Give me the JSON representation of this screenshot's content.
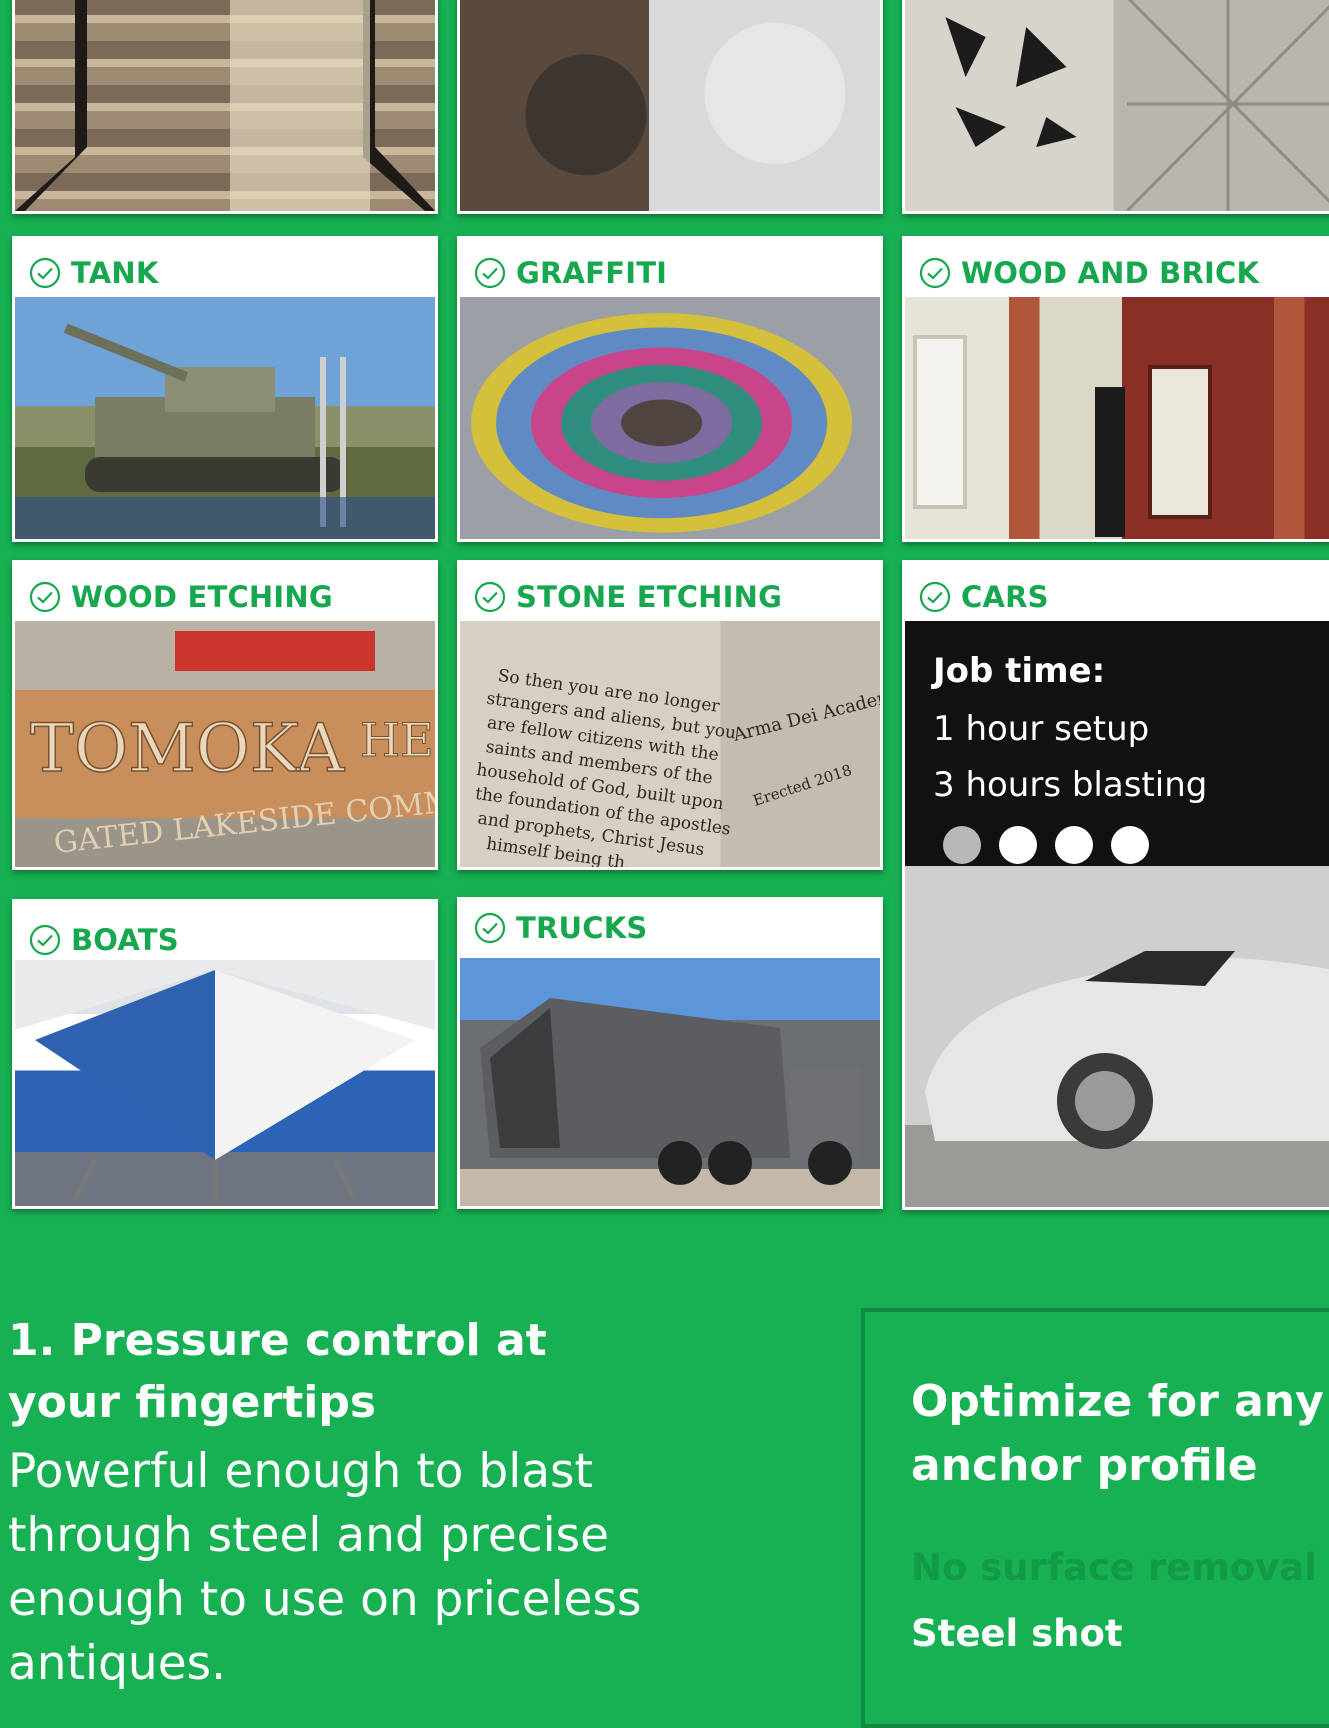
{
  "gallery": {
    "top_row": [
      {
        "name": "stairs-photo"
      },
      {
        "name": "wheels-photo"
      },
      {
        "name": "ceiling-photo"
      }
    ],
    "items": [
      {
        "label": "TANK"
      },
      {
        "label": "GRAFFITI"
      },
      {
        "label": "WOOD AND BRICK"
      },
      {
        "label": "WOOD ETCHING"
      },
      {
        "label": "STONE ETCHING"
      },
      {
        "label": "CARS"
      },
      {
        "label": "BOATS"
      },
      {
        "label": "TRUCKS"
      }
    ]
  },
  "photo_text": {
    "sign_line1": "TOMOKA",
    "sign_line1b": "HEI",
    "sign_line2": "GATED LAKESIDE COMMU",
    "stone_verse": [
      "So then you are no longer",
      "strangers and aliens, but you",
      "are fellow citizens with the",
      "saints and members of the",
      "household of God, built upon",
      "the foundation of the apostles",
      "and prophets, Christ Jesus",
      "himself being th..."
    ],
    "stone_side1": "Arma Dei Academy",
    "stone_side2": "Erected 2018"
  },
  "cars_panel": {
    "title": "Job time:",
    "line1": "1 hour setup",
    "line2": "3 hours blasting",
    "dots": 4,
    "active_dot": 0
  },
  "feature": {
    "heading_line1": "1. Pressure control at",
    "heading_line2": "your fingertips",
    "body": [
      "Powerful enough to blast",
      "through steel and precise",
      "enough to use on priceless",
      "antiques."
    ]
  },
  "optimize_box": {
    "title_line1": "Optimize for any",
    "title_line2": "anchor profile",
    "faded_item": "No surface removal",
    "item": "Steel shot"
  },
  "colors": {
    "background": "#17b153",
    "label": "#17a84f",
    "card": "#ffffff",
    "panel": "#111111"
  }
}
